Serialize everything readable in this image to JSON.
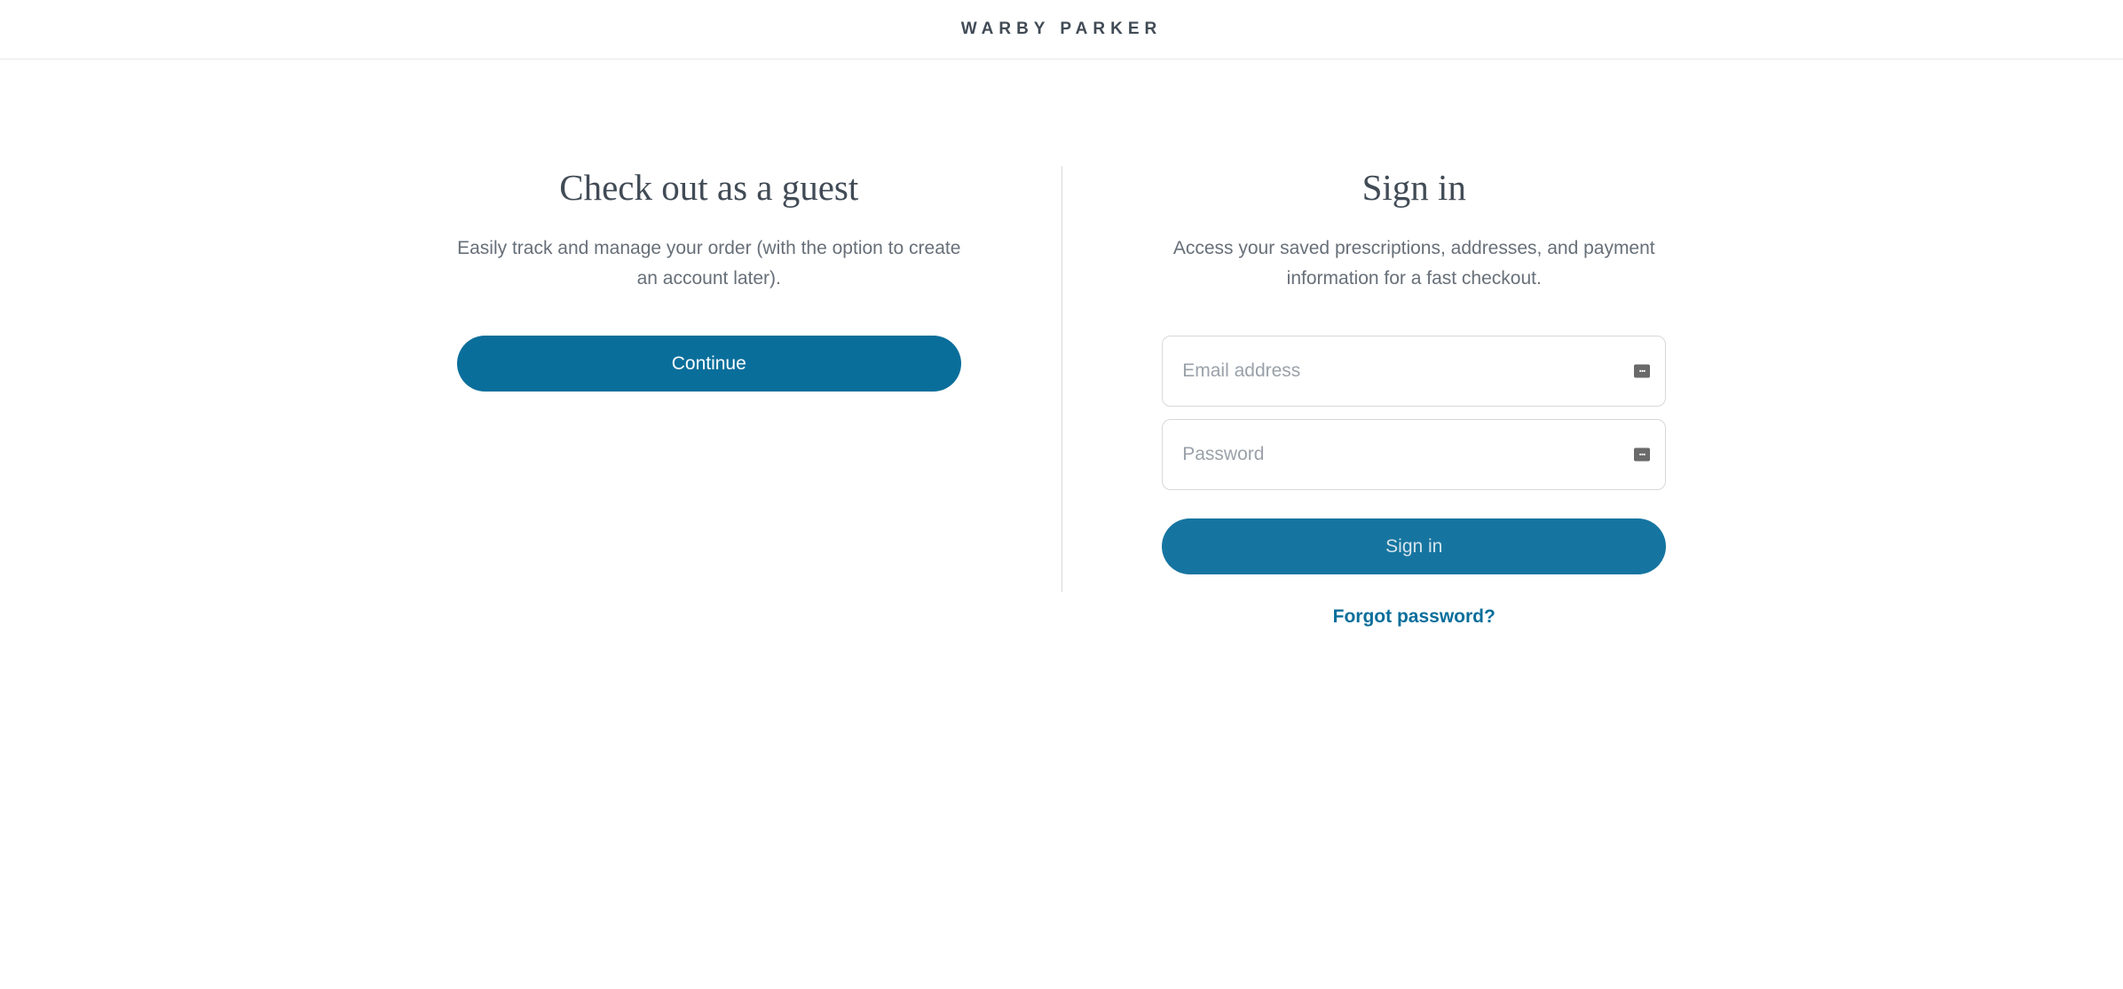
{
  "header": {
    "logo": "WARBY PARKER"
  },
  "guest": {
    "title": "Check out as a guest",
    "subtitle": "Easily track and manage your order (with the option to create an account later).",
    "continue_label": "Continue"
  },
  "signin": {
    "title": "Sign in",
    "subtitle": "Access your saved prescriptions, addresses, and payment information for a fast checkout.",
    "email_placeholder": "Email address",
    "password_placeholder": "Password",
    "signin_label": "Sign in",
    "forgot_label": "Forgot password?"
  }
}
